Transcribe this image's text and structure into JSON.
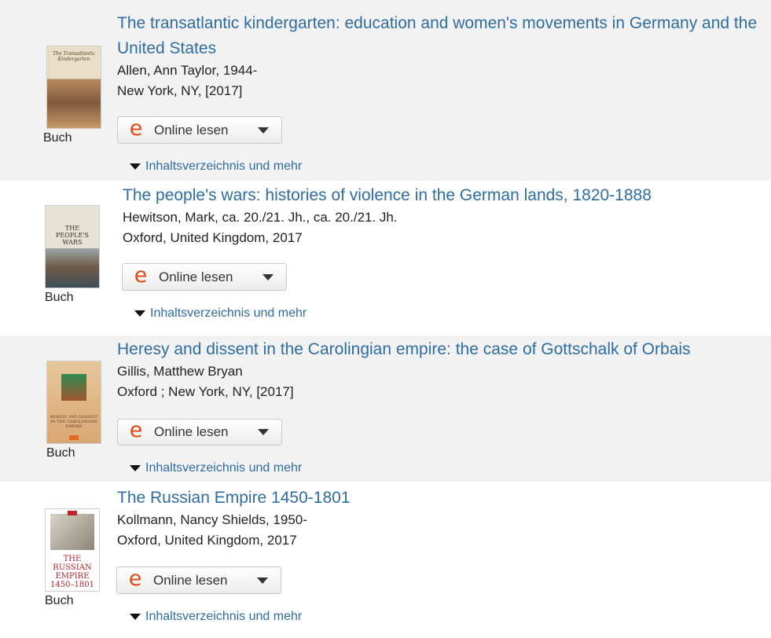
{
  "results": [
    {
      "title": "The transatlantic kindergarten: education and women's movements in Germany and the United States",
      "author": "Allen, Ann Taylor, 1944-",
      "imprint": "New York, NY, [2017]",
      "format": "Buch",
      "online_label": "Online lesen",
      "toc_label": "Inhaltsverzeichnis und mehr"
    },
    {
      "title": "The people's wars: histories of violence in the German lands, 1820-1888",
      "author": "Hewitson, Mark, ca. 20./21. Jh., ca. 20./21. Jh.",
      "imprint": "Oxford, United Kingdom, 2017",
      "format": "Buch",
      "online_label": "Online lesen",
      "toc_label": "Inhaltsverzeichnis und mehr"
    },
    {
      "title": "Heresy and dissent in the Carolingian empire: the case of Gottschalk of Orbais",
      "author": "Gillis, Matthew Bryan",
      "imprint": "Oxford ; New York, NY, [2017]",
      "format": "Buch",
      "online_label": "Online lesen",
      "toc_label": "Inhaltsverzeichnis und mehr"
    },
    {
      "title": "The Russian Empire 1450-1801",
      "author": "Kollmann, Nancy Shields, 1950-",
      "imprint": "Oxford, United Kingdom, 2017",
      "format": "Buch",
      "online_label": "Online lesen",
      "toc_label": "Inhaltsverzeichnis und mehr"
    }
  ],
  "covers": [
    {
      "text": "The Transatlantic Kindergarten"
    },
    {
      "text": "THE PEOPLE'S WARS"
    },
    {
      "text": "HERESY AND DISSENT IN THE CAROLINGIAN EMPIRE"
    },
    {
      "text": "THE RUSSIAN EMPIRE 1450–1801"
    }
  ],
  "colors": {
    "link": "#2f6da1",
    "e_icon": "#e04a17",
    "shaded_row": "#f2f2f2"
  },
  "icons": {
    "online": "e-book-icon",
    "dropdown": "chevron-down-icon",
    "toc": "caret-down-icon"
  },
  "online_icon_glyph": "e"
}
